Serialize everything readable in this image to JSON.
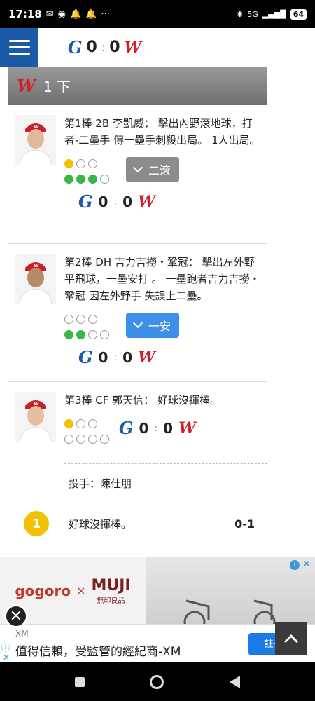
{
  "status": {
    "time": "17:18",
    "battery": "64",
    "signal": "5G"
  },
  "header": {
    "away_score": "0",
    "home_score": "0",
    "sep": ":"
  },
  "inning": {
    "label": "1 下"
  },
  "plate_appearances": [
    {
      "text": "第1棒 2B 李凱威： 擊出內野滾地球，打者-二壘手 傳一壘手刺殺出局。 1人出局。",
      "result": "二滾",
      "balls": 1,
      "strikes": 3,
      "away_score": "0",
      "home_score": "0"
    },
    {
      "text": "第2棒 DH 吉力吉撈・鞏冠： 擊出左外野平飛球，一壘安打 。 一壘跑者吉力吉撈・鞏冠 因左外野手 失誤上二壘。",
      "result": "一安",
      "balls": 0,
      "strikes": 2,
      "away_score": "0",
      "home_score": "0"
    },
    {
      "text": "第3棒 CF 郭天信： 好球沒揮棒。",
      "balls": 1,
      "strikes": 0,
      "away_score": "0",
      "home_score": "0",
      "pitcher": "投手：陳仕朋",
      "pitches": [
        {
          "num": "1",
          "desc": "好球沒揮棒。",
          "count": "0-1"
        }
      ]
    }
  ],
  "ad": {
    "brand1": "gogoro",
    "times": "×",
    "brand2": "MUJI",
    "brand2_sub": "無印良品"
  },
  "banner": {
    "source": "XM",
    "text": "值得信賴，受監管的經紀商-XM",
    "button": "註冊"
  },
  "colors": {
    "accent_blue": "#1a5aa6",
    "brand_red": "#d21f26",
    "ball_yellow": "#f2c200",
    "strike_green": "#39b54a"
  }
}
